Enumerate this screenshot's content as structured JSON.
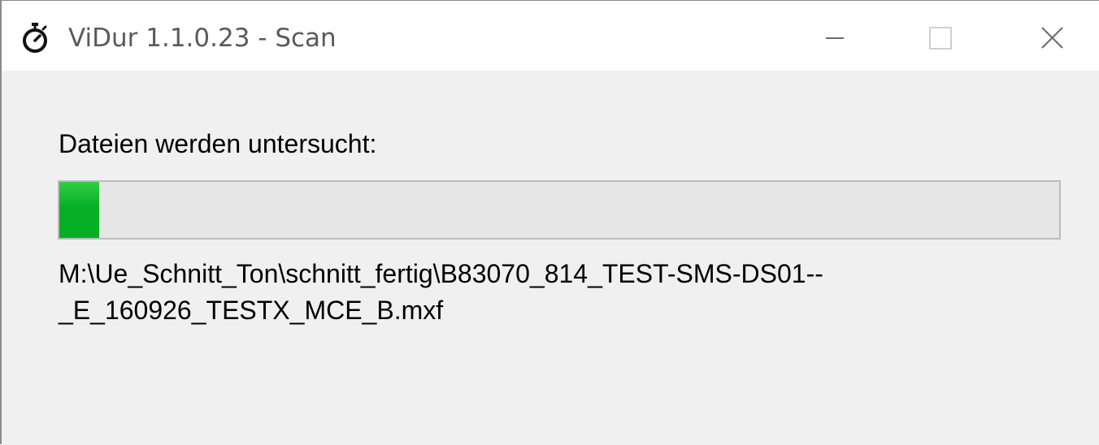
{
  "window": {
    "title": "ViDur 1.1.0.23 - Scan",
    "icon": "stopwatch-icon",
    "controls": {
      "minimize_icon": "minimize-icon",
      "maximize_icon": "maximize-icon",
      "close_icon": "close-icon"
    }
  },
  "scan": {
    "status_label": "Dateien werden untersucht:",
    "progress_fraction": 0.04,
    "progress_color": "#06b025",
    "current_file_line1": "M:\\Ue_Schnitt_Ton\\schnitt_fertig\\B83070_814_TEST-SMS-DS01--",
    "current_file_line2": "_E_160926_TESTX_MCE_B.mxf"
  }
}
